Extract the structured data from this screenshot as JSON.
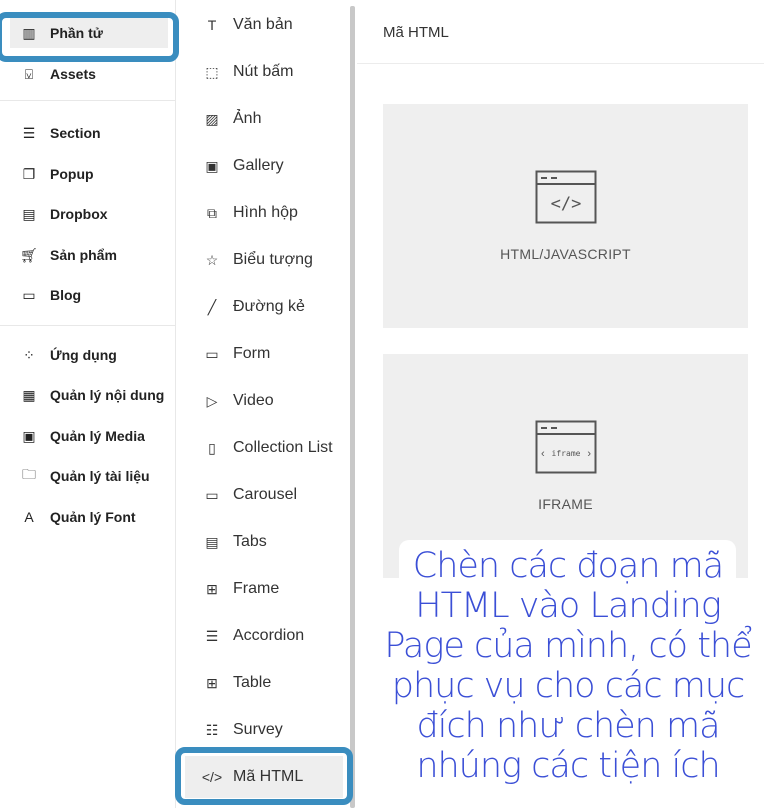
{
  "left_sidebar": {
    "items": [
      {
        "label": "Phần tử",
        "icon": "elements-icon"
      },
      {
        "label": "Assets",
        "icon": "bookmark-icon"
      },
      {
        "label": "Section",
        "icon": "section-icon"
      },
      {
        "label": "Popup",
        "icon": "popup-icon"
      },
      {
        "label": "Dropbox",
        "icon": "dropbox-icon"
      },
      {
        "label": "Sản phẩm",
        "icon": "cart-icon"
      },
      {
        "label": "Blog",
        "icon": "monitor-icon"
      },
      {
        "label": "Ứng dụng",
        "icon": "apps-icon"
      },
      {
        "label": "Quản lý nội dung",
        "icon": "content-icon"
      },
      {
        "label": "Quản lý Media",
        "icon": "media-icon"
      },
      {
        "label": "Quản lý tài liệu",
        "icon": "folder-icon"
      },
      {
        "label": "Quản lý Font",
        "icon": "font-icon"
      }
    ]
  },
  "element_panel": {
    "items": [
      {
        "label": "Văn bản",
        "glyph": "T"
      },
      {
        "label": "Nút bấm",
        "glyph": "⬚"
      },
      {
        "label": "Ảnh",
        "glyph": "▨"
      },
      {
        "label": "Gallery",
        "glyph": "▣"
      },
      {
        "label": "Hình hộp",
        "glyph": "⧉"
      },
      {
        "label": "Biểu tượng",
        "glyph": "☆"
      },
      {
        "label": "Đường kẻ",
        "glyph": "╱"
      },
      {
        "label": "Form",
        "glyph": "▭"
      },
      {
        "label": "Video",
        "glyph": "▷"
      },
      {
        "label": "Collection List",
        "glyph": "▯"
      },
      {
        "label": "Carousel",
        "glyph": "▭"
      },
      {
        "label": "Tabs",
        "glyph": "▤"
      },
      {
        "label": "Frame",
        "glyph": "⊞"
      },
      {
        "label": "Accordion",
        "glyph": "☰"
      },
      {
        "label": "Table",
        "glyph": "⊞"
      },
      {
        "label": "Survey",
        "glyph": "☷"
      },
      {
        "label": "Mã HTML",
        "glyph": "</>"
      }
    ]
  },
  "main": {
    "title": "Mã HTML",
    "cards": [
      {
        "label": "HTML/JAVASCRIPT",
        "icon_text": "</>"
      },
      {
        "label": "IFRAME",
        "icon_text": "iframe"
      }
    ]
  },
  "annotation": {
    "text": "Chèn các đoạn mã HTML vào Landing Page của mình, có thể phục vụ cho các mục đích như chèn mã nhúng các tiện ích",
    "color": "#3b4fd6"
  },
  "highlight_color": "#3a8dbf"
}
